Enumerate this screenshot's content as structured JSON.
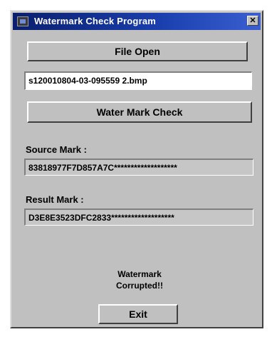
{
  "window": {
    "title": "Watermark Check Program",
    "close_glyph": "✕"
  },
  "file_open_label": "File Open",
  "file_path": "s120010804-03-095559 2.bmp",
  "check_button_label": "Water Mark Check",
  "source": {
    "label": "Source Mark :",
    "value": "83818977F7D857A7C*******************"
  },
  "result": {
    "label": "Result Mark :",
    "value": "D3E8E3523DFC2833*******************"
  },
  "status": {
    "line1": "Watermark",
    "line2": "Corrupted!!"
  },
  "exit_label": "Exit",
  "icons": {
    "app": "app-window-icon",
    "close": "close-icon"
  }
}
